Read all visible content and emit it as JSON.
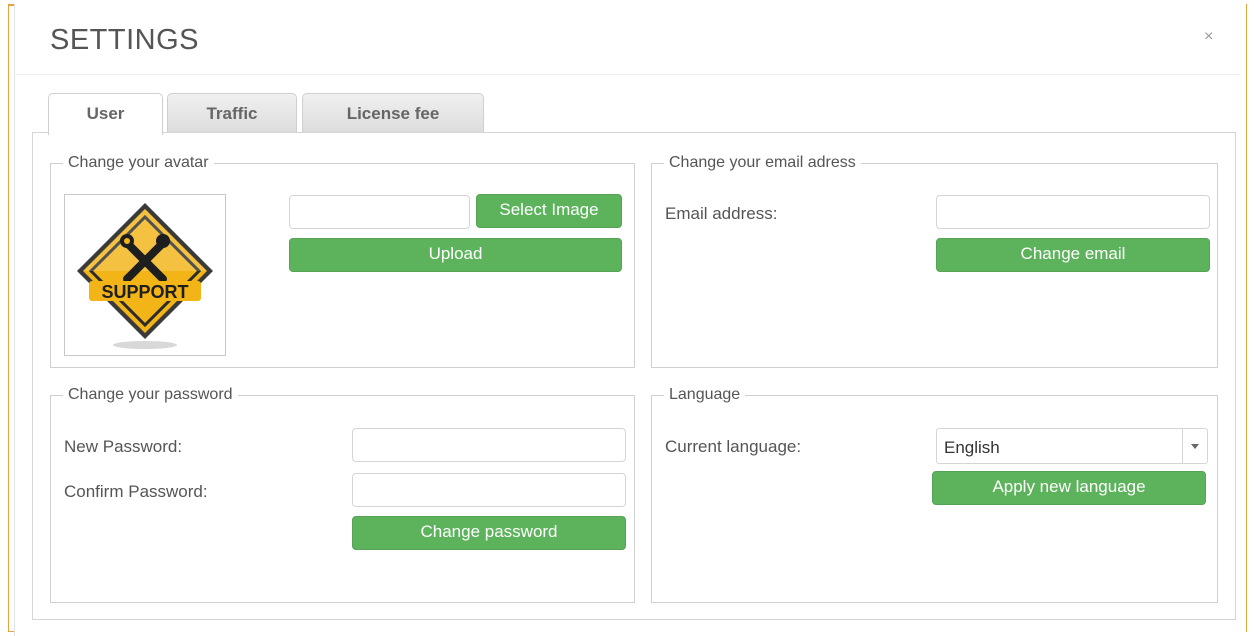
{
  "dialog": {
    "title": "SETTINGS",
    "close_glyph": "×"
  },
  "tabs": [
    {
      "label": "User",
      "active": true
    },
    {
      "label": "Traffic",
      "active": false
    },
    {
      "label": "License fee",
      "active": false
    }
  ],
  "avatar": {
    "legend": "Change your avatar",
    "file_input_value": "",
    "select_button": "Select Image",
    "upload_button": "Upload",
    "image_text": "SUPPORT"
  },
  "email": {
    "legend": "Change your email adress",
    "label": "Email address:",
    "input_value": "",
    "button": "Change email"
  },
  "password": {
    "legend": "Change your password",
    "new_label": "New Password:",
    "confirm_label": "Confirm Password:",
    "new_value": "",
    "confirm_value": "",
    "button": "Change password"
  },
  "language": {
    "legend": "Language",
    "label": "Current language:",
    "selected": "English",
    "button": "Apply new language"
  },
  "colors": {
    "accent_green": "#5cb35c",
    "window_border": "#e8a33c",
    "sign_yellow": "#f2b416"
  },
  "icons": {
    "close": "close-icon",
    "select_arrow": "chevron-down-icon",
    "avatar": "support-sign-icon"
  }
}
